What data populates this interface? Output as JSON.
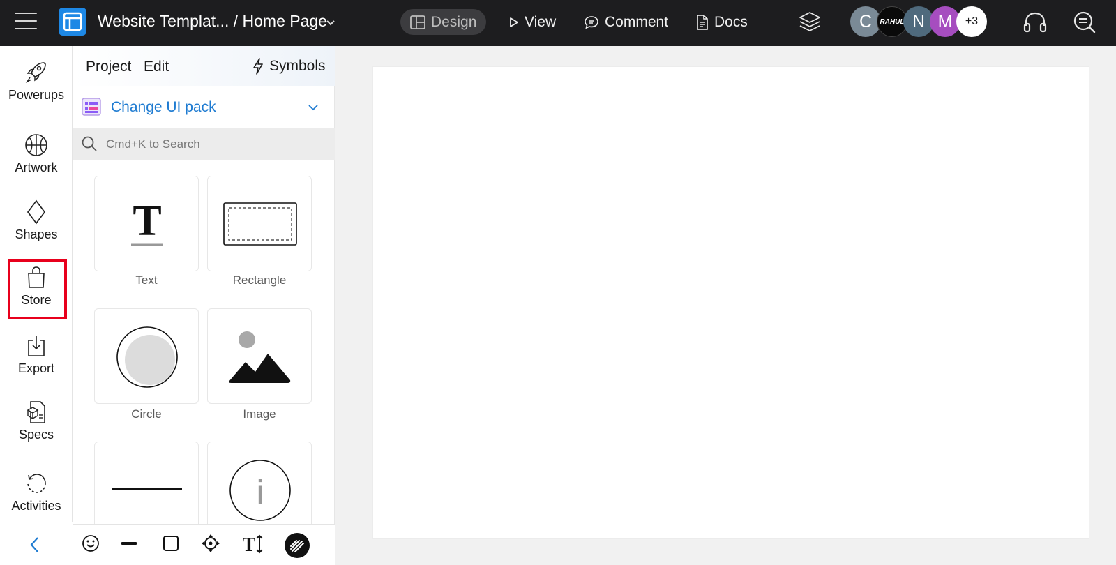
{
  "topbar": {
    "project_title": "Website Templat... / Home Page",
    "nav": [
      {
        "label": "Design",
        "icon": "layout-icon",
        "active": true
      },
      {
        "label": "View",
        "icon": "play-icon",
        "active": false
      },
      {
        "label": "Comment",
        "icon": "comment-icon",
        "active": false
      },
      {
        "label": "Docs",
        "icon": "document-icon",
        "active": false
      }
    ],
    "avatars": [
      {
        "initial": "C",
        "color": "#7a8a96"
      },
      {
        "initial": "RAHUL",
        "color": "#0a0a0a"
      },
      {
        "initial": "N",
        "color": "#4f6a7d"
      },
      {
        "initial": "M",
        "color": "#a64dbf"
      },
      {
        "initial": "+3",
        "color": "#ffffff"
      }
    ]
  },
  "rail": {
    "items": [
      {
        "label": "Powerups",
        "icon": "rocket-icon"
      },
      {
        "label": "Artwork",
        "icon": "basketball-icon"
      },
      {
        "label": "Shapes",
        "icon": "diamond-icon"
      },
      {
        "label": "Store",
        "icon": "shopping-bag-icon",
        "highlighted": true
      },
      {
        "label": "Export",
        "icon": "download-icon"
      },
      {
        "label": "Specs",
        "icon": "specs-icon"
      },
      {
        "label": "Activities",
        "icon": "history-icon"
      }
    ]
  },
  "panel": {
    "tabs": {
      "project": "Project",
      "edit": "Edit",
      "symbols": "Symbols"
    },
    "ui_pack_label": "Change UI pack",
    "search_placeholder": "Cmd+K to Search",
    "tiles": [
      {
        "label": "Text"
      },
      {
        "label": "Rectangle"
      },
      {
        "label": "Circle"
      },
      {
        "label": "Image"
      },
      {
        "label": ""
      },
      {
        "label": ""
      }
    ]
  },
  "bottom_toolbar": {
    "icons": [
      "emoji-icon",
      "line-tool-icon",
      "square-tool-icon",
      "move-tool-icon",
      "text-size-icon",
      "sketch-icon"
    ]
  },
  "colors": {
    "topbar": "#1d1d1f",
    "accent": "#1e7bd1",
    "highlight": "#e8001c"
  }
}
